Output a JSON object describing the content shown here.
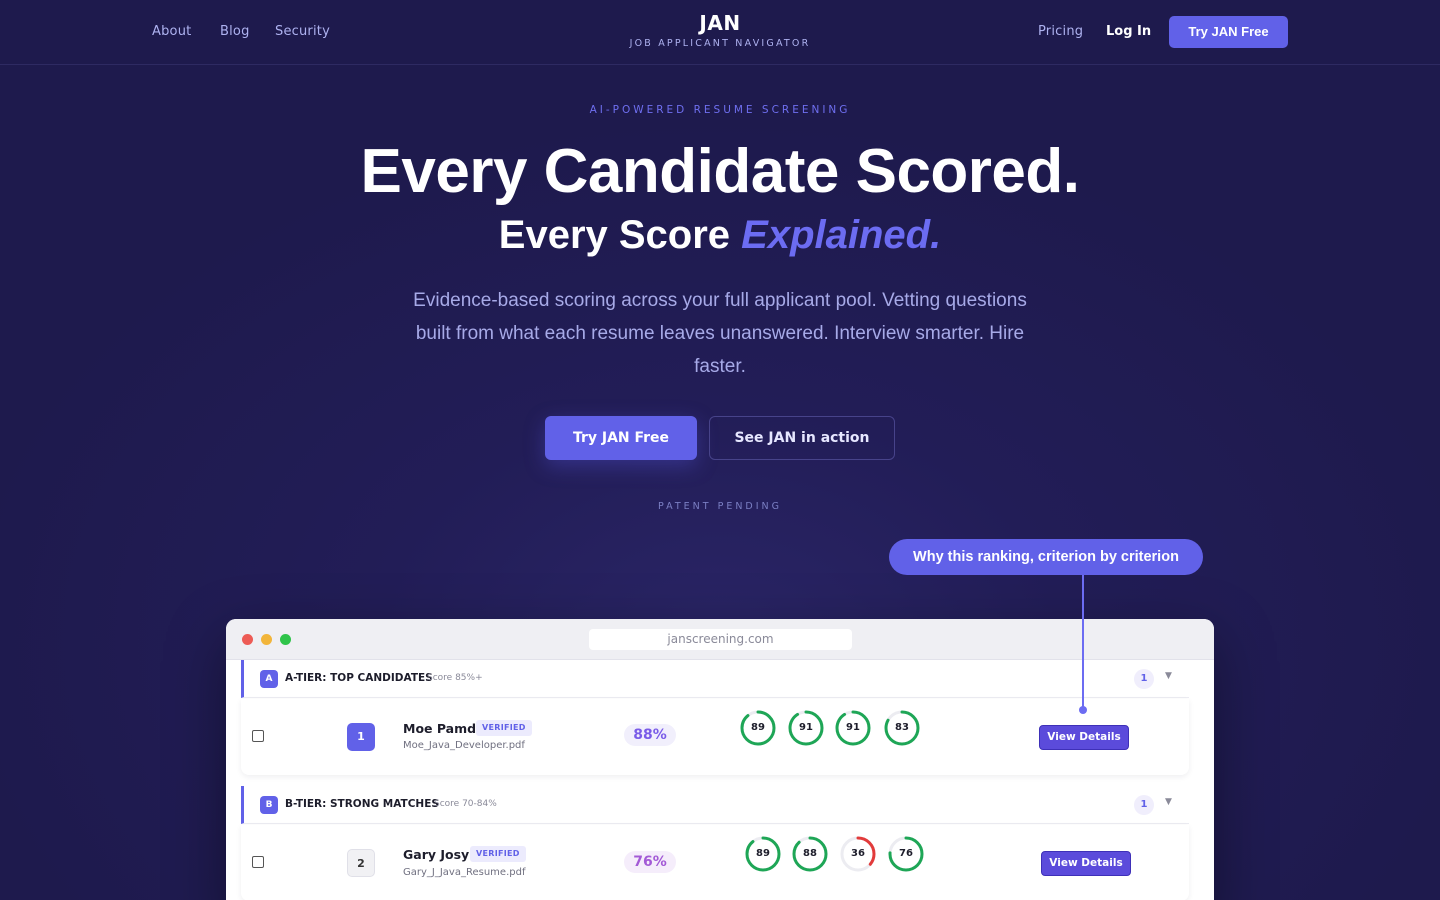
{
  "nav": {
    "left_links": [
      "About",
      "Blog",
      "Security"
    ],
    "logo_title": "JAN",
    "logo_subtitle": "JOB APPLICANT NAVIGATOR",
    "pricing": "Pricing",
    "login": "Log In",
    "cta": "Try JAN Free"
  },
  "hero": {
    "eyebrow": "AI-POWERED RESUME SCREENING",
    "headline": "Every Candidate Scored.",
    "subheadline_plain": "Every Score ",
    "subheadline_accent": "Explained.",
    "lede": "Evidence-based scoring across your full applicant pool. Vetting questions built from what each resume leaves unanswered. Interview smarter. Hire faster.",
    "primary_cta": "Try JAN Free",
    "secondary_cta": "See JAN in action",
    "patent": "PATENT PENDING"
  },
  "callout": "Why this ranking, criterion by criterion",
  "browser": {
    "url": "janscreening.com",
    "tiers": [
      {
        "badge": "A",
        "title": "A-TIER: TOP CANDIDATES",
        "range": "Score 85%+",
        "count": "1",
        "candidate": {
          "rank": "1",
          "name": "Moe Pamdi",
          "verified": "VERIFIED",
          "file": "Moe_Java_Developer.pdf",
          "score": "88%",
          "criteria": [
            89,
            91,
            91,
            83
          ],
          "action": "View Details"
        }
      },
      {
        "badge": "B",
        "title": "B-TIER: STRONG MATCHES",
        "range": "Score 70-84%",
        "count": "1",
        "candidate": {
          "rank": "2",
          "name": "Gary Josy",
          "verified": "VERIFIED",
          "file": "Gary_J_Java_Resume.pdf",
          "score": "76%",
          "criteria": [
            89,
            88,
            36,
            76
          ],
          "action": "View Details"
        }
      }
    ]
  },
  "colors": {
    "background": "#1e1a4d",
    "accent": "#6161e8",
    "gauge_good": "#1ea656",
    "gauge_bad": "#e23b3b",
    "traffic_red": "#ed5b55",
    "traffic_yellow": "#f2b53a",
    "traffic_green": "#2fc44a"
  }
}
